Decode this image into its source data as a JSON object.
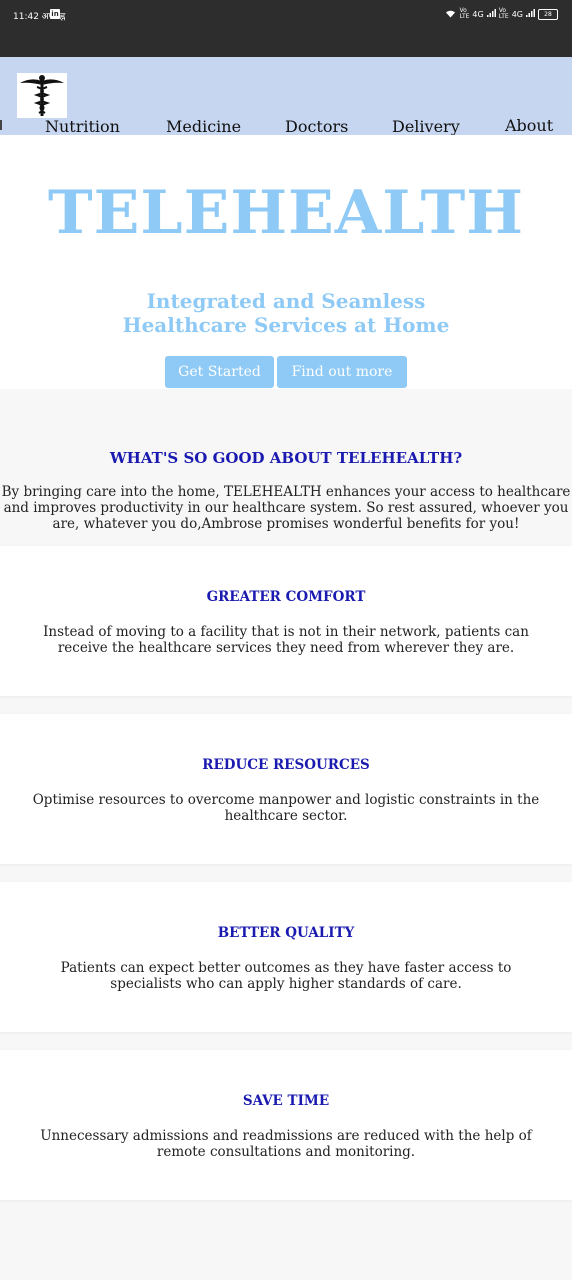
{
  "status_bar": {
    "time": "11:42 अपराह्न",
    "linkedin_badge": "in",
    "signal_text": "4G",
    "battery": "28"
  },
  "nav": {
    "items": [
      "Nutrition",
      "Medicine",
      "Doctors",
      "Delivery",
      "About Us"
    ],
    "logo_icon": "caduceus-icon"
  },
  "hero": {
    "title": "TELEHEALTH",
    "subtitle_line1": "Integrated and Seamless",
    "subtitle_line2": "Healthcare Services at Home",
    "primary_button": "Get Started",
    "secondary_button": "Find out more"
  },
  "about": {
    "heading": "WHAT'S SO GOOD ABOUT TELEHEALTH?",
    "text": "By bringing care into the home, TELEHEALTH enhances your access to healthcare and improves productivity in our healthcare system. So rest assured, whoever you are, whatever you do,Ambrose promises wonderful benefits for you!"
  },
  "benefits": [
    {
      "title": "GREATER COMFORT",
      "text": "Instead of moving to a facility that is not in their network, patients can receive the healthcare services they need from wherever they are."
    },
    {
      "title": "REDUCE RESOURCES",
      "text": "Optimise resources to overcome manpower and logistic constraints in the healthcare sector."
    },
    {
      "title": "BETTER QUALITY",
      "text": "Patients can expect better outcomes as they have faster access to specialists who can apply higher standards of care."
    },
    {
      "title": "SAVE TIME",
      "text": "Unnecessary admissions and readmissions are reduced with the help of remote consultations and monitoring."
    }
  ],
  "colors": {
    "accent": "#8ecaf5",
    "heading_blue": "#1a1ab0",
    "nav_bg": "#c6d6f0",
    "statusbar_bg": "#2d2d2d"
  }
}
